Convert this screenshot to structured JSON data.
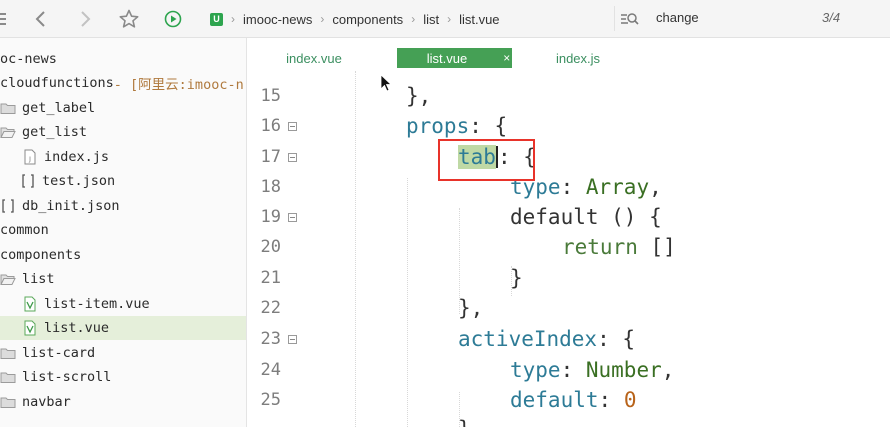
{
  "breadcrumb": {
    "segments": [
      "imooc-news",
      "components",
      "list",
      "list.vue"
    ]
  },
  "search": {
    "query": "change",
    "count": "3/4"
  },
  "sidebar": {
    "items": [
      {
        "label": "oc-news",
        "icon": "none"
      },
      {
        "label": "cloudfunctions",
        "extra": " - [阿里云:imooc-n",
        "icon": "none"
      },
      {
        "label": "get_label",
        "icon": "folder-icon"
      },
      {
        "label": "get_list",
        "icon": "folder-open-icon"
      },
      {
        "label": "index.js",
        "icon": "js-file-icon"
      },
      {
        "label": "test.json",
        "icon": "json-file-icon"
      },
      {
        "label": "db_init.json",
        "icon": "json-file-icon"
      },
      {
        "label": "common",
        "icon": "none"
      },
      {
        "label": "components",
        "icon": "none"
      },
      {
        "label": "list",
        "icon": "folder-open-icon"
      },
      {
        "label": "list-item.vue",
        "icon": "vue-file-icon"
      },
      {
        "label": "list.vue",
        "icon": "vue-file-icon",
        "selected": true
      },
      {
        "label": "list-card",
        "icon": "folder-icon"
      },
      {
        "label": "list-scroll",
        "icon": "folder-icon"
      },
      {
        "label": "navbar",
        "icon": "folder-icon"
      }
    ]
  },
  "tabs": [
    {
      "label": "index.vue",
      "active": false
    },
    {
      "label": "list.vue",
      "active": true,
      "close": "×"
    },
    {
      "label": "index.js",
      "active": false
    }
  ],
  "editor": {
    "lines": [
      {
        "num": "15",
        "fold": false
      },
      {
        "num": "16",
        "fold": true
      },
      {
        "num": "17",
        "fold": true
      },
      {
        "num": "18",
        "fold": false
      },
      {
        "num": "19",
        "fold": true
      },
      {
        "num": "20",
        "fold": false
      },
      {
        "num": "21",
        "fold": false
      },
      {
        "num": "22",
        "fold": false
      },
      {
        "num": "23",
        "fold": true
      },
      {
        "num": "24",
        "fold": false
      },
      {
        "num": "25",
        "fold": false
      }
    ],
    "code": {
      "l15": "},",
      "l16_key": "props",
      "l16_rest": ": {",
      "l17_key": "tab",
      "l17_rest": ": {",
      "l18_key": "type",
      "l18_sep": ": ",
      "l18_val": "Array",
      "l18_end": ",",
      "l19_key": "default",
      "l19_rest": " () {",
      "l20_kw": "return",
      "l20_rest": " []",
      "l21": "}",
      "l22": "},",
      "l23_key": "activeIndex",
      "l23_rest": ": {",
      "l24_key": "type",
      "l24_sep": ": ",
      "l24_val": "Number",
      "l24_end": ",",
      "l25_key": "default",
      "l25_sep": ": ",
      "l25_val": "0"
    }
  }
}
